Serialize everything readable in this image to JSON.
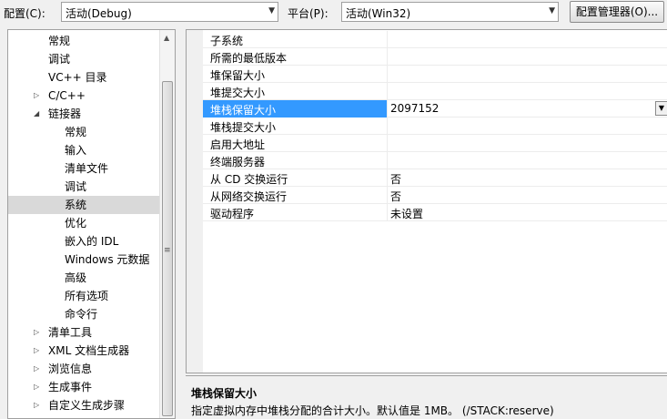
{
  "toolbar": {
    "config_label": "配置(C):",
    "config_value": "活动(Debug)",
    "platform_label": "平台(P):",
    "platform_value": "活动(Win32)",
    "config_manager_label": "配置管理器(O)..."
  },
  "tree": {
    "items": [
      {
        "label": "常规",
        "level": 1,
        "expander": ""
      },
      {
        "label": "调试",
        "level": 1,
        "expander": ""
      },
      {
        "label": "VC++ 目录",
        "level": 1,
        "expander": ""
      },
      {
        "label": "C/C++",
        "level": 1,
        "expander": "collapsed"
      },
      {
        "label": "链接器",
        "level": 1,
        "expander": "expanded"
      },
      {
        "label": "常规",
        "level": 2,
        "expander": ""
      },
      {
        "label": "输入",
        "level": 2,
        "expander": ""
      },
      {
        "label": "清单文件",
        "level": 2,
        "expander": ""
      },
      {
        "label": "调试",
        "level": 2,
        "expander": ""
      },
      {
        "label": "系统",
        "level": 2,
        "expander": "",
        "selected": true
      },
      {
        "label": "优化",
        "level": 2,
        "expander": ""
      },
      {
        "label": "嵌入的 IDL",
        "level": 2,
        "expander": ""
      },
      {
        "label": "Windows 元数据",
        "level": 2,
        "expander": ""
      },
      {
        "label": "高级",
        "level": 2,
        "expander": ""
      },
      {
        "label": "所有选项",
        "level": 2,
        "expander": ""
      },
      {
        "label": "命令行",
        "level": 2,
        "expander": ""
      },
      {
        "label": "清单工具",
        "level": 1,
        "expander": "collapsed"
      },
      {
        "label": "XML 文档生成器",
        "level": 1,
        "expander": "collapsed"
      },
      {
        "label": "浏览信息",
        "level": 1,
        "expander": "collapsed"
      },
      {
        "label": "生成事件",
        "level": 1,
        "expander": "collapsed"
      },
      {
        "label": "自定义生成步骤",
        "level": 1,
        "expander": "collapsed"
      }
    ]
  },
  "properties": [
    {
      "name": "子系统",
      "value": ""
    },
    {
      "name": "所需的最低版本",
      "value": ""
    },
    {
      "name": "堆保留大小",
      "value": ""
    },
    {
      "name": "堆提交大小",
      "value": ""
    },
    {
      "name": "堆栈保留大小",
      "value": "2097152",
      "selected": true
    },
    {
      "name": "堆栈提交大小",
      "value": ""
    },
    {
      "name": "启用大地址",
      "value": ""
    },
    {
      "name": "终端服务器",
      "value": ""
    },
    {
      "name": "从 CD 交换运行",
      "value": "否"
    },
    {
      "name": "从网络交换运行",
      "value": "否"
    },
    {
      "name": "驱动程序",
      "value": "未设置"
    }
  ],
  "description": {
    "title": "堆栈保留大小",
    "text": "指定虚拟内存中堆栈分配的合计大小。默认值是 1MB。    (/STACK:reserve)"
  }
}
